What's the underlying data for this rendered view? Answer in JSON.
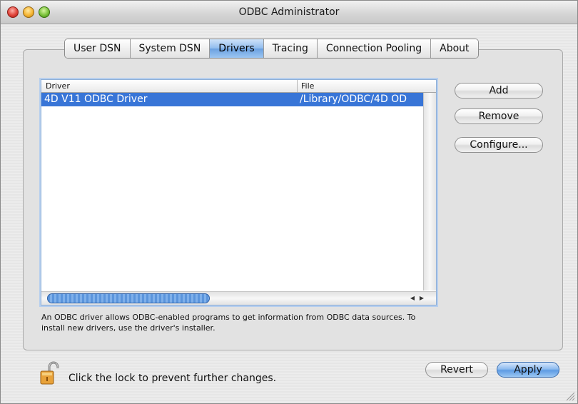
{
  "window": {
    "title": "ODBC Administrator"
  },
  "tabs": [
    {
      "label": "User DSN",
      "active": false
    },
    {
      "label": "System DSN",
      "active": false
    },
    {
      "label": "Drivers",
      "active": true
    },
    {
      "label": "Tracing",
      "active": false
    },
    {
      "label": "Connection Pooling",
      "active": false
    },
    {
      "label": "About",
      "active": false
    }
  ],
  "drivers_table": {
    "columns": [
      "Driver",
      "File"
    ],
    "rows": [
      {
        "driver": "4D V11 ODBC Driver",
        "file": "/Library/ODBC/4D OD",
        "selected": true
      }
    ]
  },
  "buttons": {
    "add": "Add",
    "remove": "Remove",
    "configure": "Configure...",
    "revert": "Revert",
    "apply": "Apply"
  },
  "description": "An ODBC driver allows ODBC-enabled programs to get information from ODBC data sources. To install new drivers, use the driver's installer.",
  "lock": {
    "message": "Click the lock to prevent further changes.",
    "state": "unlocked"
  },
  "colors": {
    "selection": "#3875d7",
    "primary_button": "#5e9be3",
    "active_tab": "#6aa0e0"
  },
  "icons": {
    "lock": "lock-open-icon",
    "scroll_left": "arrow-left-icon",
    "scroll_right": "arrow-right-icon",
    "resize": "resize-grip-icon"
  }
}
